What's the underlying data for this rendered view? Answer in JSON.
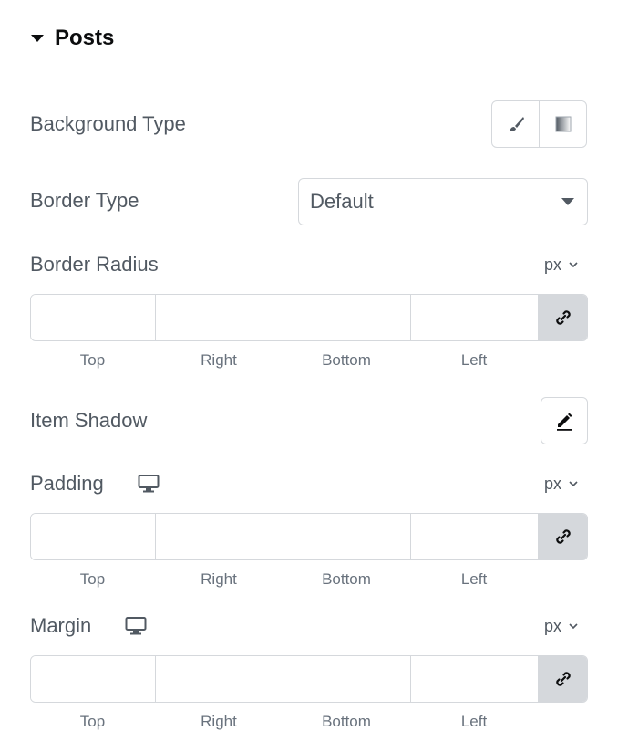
{
  "section": {
    "title": "Posts",
    "expand_icon": "caret-down-icon"
  },
  "background_type": {
    "label": "Background Type",
    "options": [
      {
        "icon": "brush-icon",
        "name": "Classic"
      },
      {
        "icon": "gradient-icon",
        "name": "Gradient"
      }
    ]
  },
  "border_type": {
    "label": "Border Type",
    "value": "Default"
  },
  "border_radius": {
    "label": "Border Radius",
    "unit": "px",
    "sides": [
      "Top",
      "Right",
      "Bottom",
      "Left"
    ],
    "values": [
      "",
      "",
      "",
      ""
    ],
    "link_icon": "link-icon"
  },
  "item_shadow": {
    "label": "Item Shadow",
    "icon": "pencil-icon"
  },
  "padding": {
    "label": "Padding",
    "device_icon": "desktop-icon",
    "unit": "px",
    "sides": [
      "Top",
      "Right",
      "Bottom",
      "Left"
    ],
    "values": [
      "",
      "",
      "",
      ""
    ],
    "link_icon": "link-icon"
  },
  "margin": {
    "label": "Margin",
    "device_icon": "desktop-icon",
    "unit": "px",
    "sides": [
      "Top",
      "Right",
      "Bottom",
      "Left"
    ],
    "values": [
      "",
      "",
      "",
      ""
    ],
    "link_icon": "link-icon"
  }
}
